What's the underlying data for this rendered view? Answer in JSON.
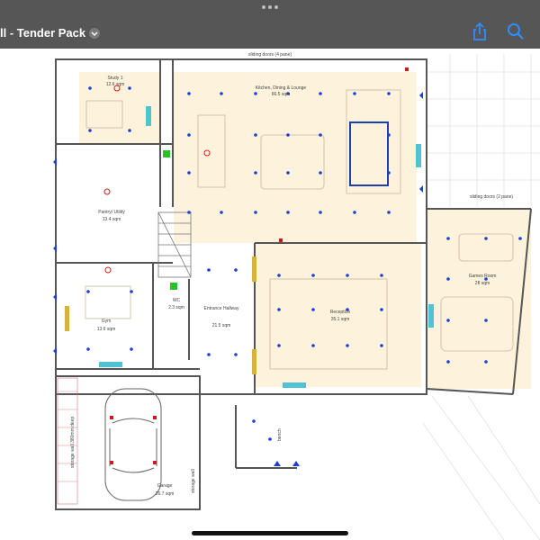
{
  "toolbar": {
    "title": "ll - Tender Pack",
    "share_icon": "share-icon",
    "search_icon": "search-icon",
    "dropdown_icon": "chevron-down-icon"
  },
  "plan": {
    "rooms": {
      "study": {
        "name": "Study 1",
        "area": "12.6 sqm"
      },
      "kitchen": {
        "name": "Kitchen, Dining & Lounge",
        "area": "66.5 sqm"
      },
      "pantry": {
        "name": "Pantry/ Utility",
        "area": "13.4 sqm"
      },
      "wc": {
        "name": "WC",
        "area": "2.3 sqm"
      },
      "entrance": {
        "name": "Entrance Hallway",
        "area": "21.5 sqm"
      },
      "reception": {
        "name": "Reception",
        "area": "35.1 sqm"
      },
      "games": {
        "name": "Games Room",
        "area": "28 sqm"
      },
      "gym": {
        "name": "Gym",
        "area": "13.6 sqm"
      },
      "garage": {
        "name": "Garage",
        "area": "26.7 sqm"
      }
    },
    "notes": {
      "sliding_top": "sliding doors (4 pane)",
      "sliding_right": "sliding doors (2 pane)",
      "storage_left": "storage wall 380mm deep",
      "storage_right": "storage wall",
      "bench": "bench"
    },
    "colors": {
      "room_fill": "#fdf3dc",
      "wall": "#555555",
      "light_dot": "#1f3fd0",
      "feature": "#1b3fb0",
      "radiator": "#4fc3d4",
      "warning": "#d01a1a"
    }
  }
}
